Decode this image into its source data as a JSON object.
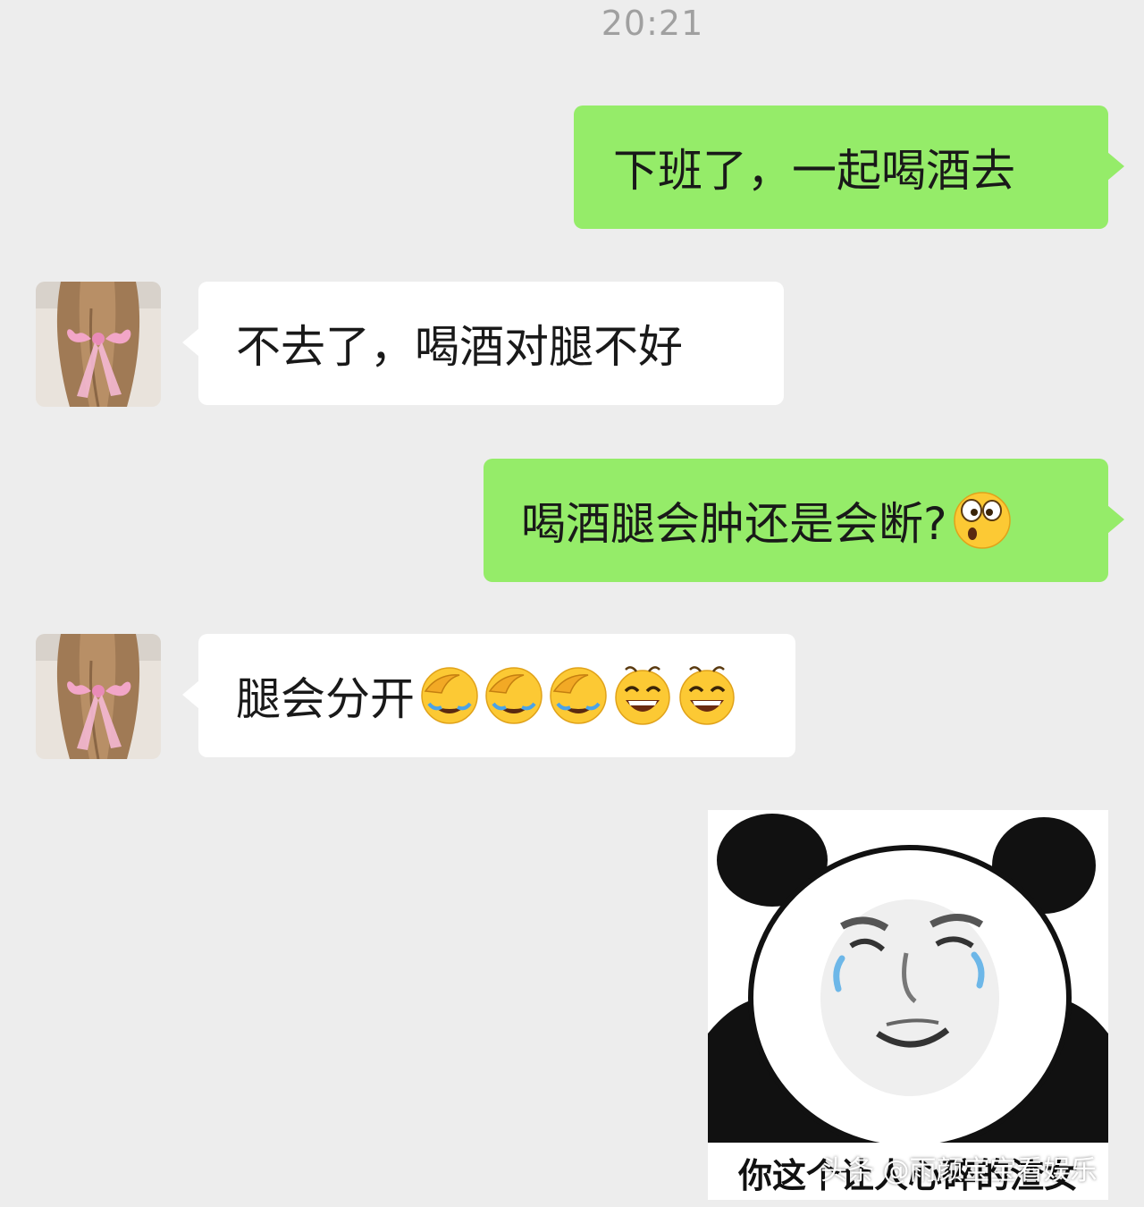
{
  "chat": {
    "timestamp": "20:21",
    "messages": [
      {
        "sender": "me",
        "text": "下班了，一起喝酒去",
        "emojis": []
      },
      {
        "sender": "contact",
        "text": "不去了，喝酒对腿不好",
        "emojis": []
      },
      {
        "sender": "me",
        "text": "喝酒腿会肿还是会断?",
        "emojis": [
          "surprised-emoji"
        ]
      },
      {
        "sender": "contact",
        "text": "腿会分开",
        "emojis": [
          "facepalm-laugh-emoji",
          "facepalm-laugh-emoji",
          "facepalm-laugh-emoji",
          "grin-emoji",
          "grin-emoji"
        ]
      },
      {
        "sender": "me",
        "type": "sticker",
        "sticker": "crying-panda-meme",
        "caption": "你这个让人心碎的渣女"
      }
    ]
  },
  "watermark": "头条 @雨颜宝宝看娱乐",
  "colors": {
    "background": "#ededed",
    "outgoing_bubble": "#95ec69",
    "incoming_bubble": "#ffffff",
    "timestamp": "#a0a0a0"
  }
}
